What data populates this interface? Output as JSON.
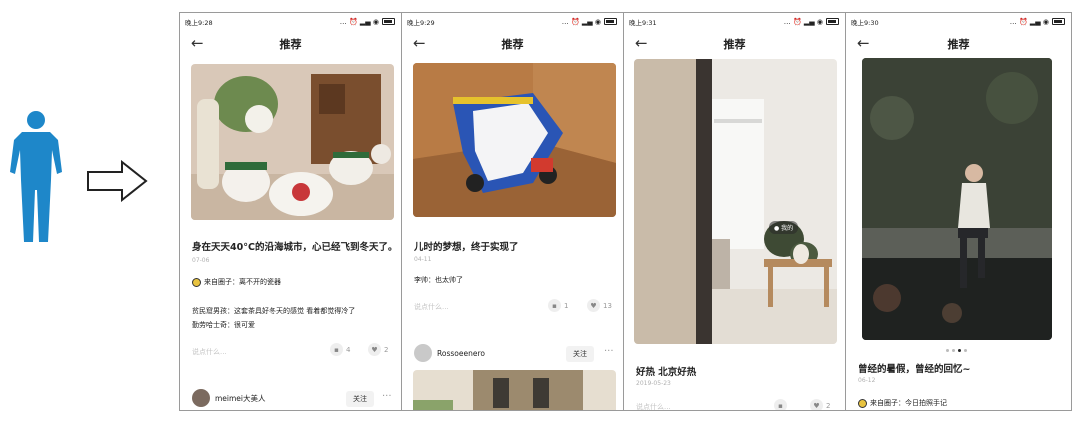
{
  "colors": {
    "accent_circle": "#e8c340",
    "person": "#1e87c9"
  },
  "phones": [
    {
      "status": {
        "time": "晚上9:28",
        "icons": "… ⏰ ▂▄ ◉"
      },
      "nav": {
        "back": "←",
        "title": "推荐"
      },
      "post": {
        "title": "身在天天40°C的沿海城市，心已经飞到冬天了。",
        "date": "07-06",
        "circle": "来自圈子：离不开的瓷器",
        "comments": [
          "贫民窟男孩：这套茶具好冬天的感觉 看着都觉得冷了",
          "勤劳哈士奇：很可爱"
        ],
        "say_placeholder": "说点什么...",
        "comment_count": "4",
        "like_count": "2",
        "author": "meimei大美人",
        "follow": "关注",
        "more": "···"
      }
    },
    {
      "status": {
        "time": "晚上9:29",
        "icons": "… ⏰ ▂▄ ◉"
      },
      "nav": {
        "back": "←",
        "title": "推荐"
      },
      "post": {
        "title": "儿时的梦想，终于实现了",
        "date": "04-11",
        "comments": [
          "李帅：也太帅了"
        ],
        "say_placeholder": "说点什么...",
        "comment_count": "1",
        "like_count": "13",
        "author": "Rossoeenero",
        "follow": "关注",
        "more": "···"
      }
    },
    {
      "status": {
        "time": "晚上9:31",
        "icons": "… ⏰ ▂▄ ◉"
      },
      "nav": {
        "back": "←",
        "title": "推荐"
      },
      "post": {
        "image_tag": "● 我的",
        "title": "好热 北京好热",
        "date": "2019-05-23",
        "say_placeholder": "说点什么...",
        "like_count": "2"
      }
    },
    {
      "status": {
        "time": "晚上9:30",
        "icons": "… ⏰ ▂▄ ◉"
      },
      "nav": {
        "back": "←",
        "title": "推荐"
      },
      "post": {
        "title": "曾经的暑假，曾经的回忆~",
        "date": "06-12",
        "circle": "来自圈子：今日拍照手记"
      }
    }
  ]
}
